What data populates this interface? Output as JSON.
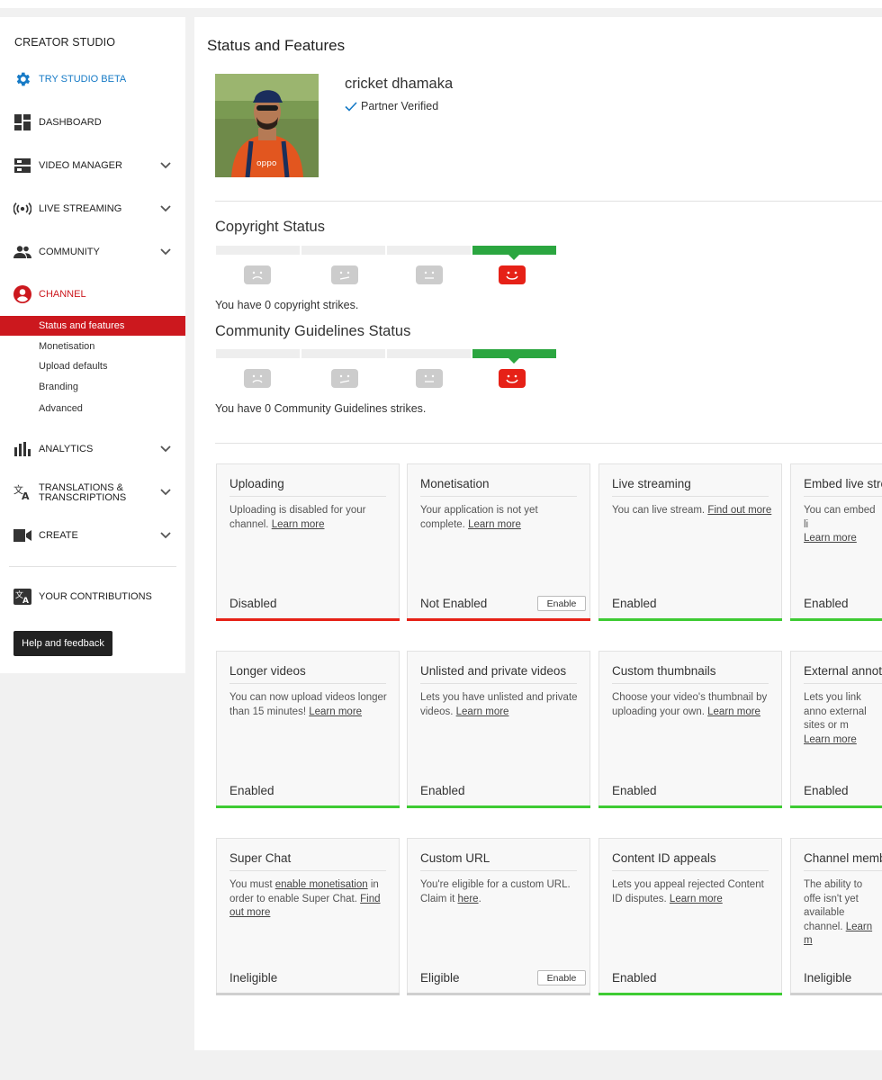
{
  "sidebar": {
    "title": "CREATOR STUDIO",
    "try_beta": "TRY STUDIO BETA",
    "dashboard": "DASHBOARD",
    "video_manager": "VIDEO MANAGER",
    "live_streaming": "LIVE STREAMING",
    "community": "COMMUNITY",
    "channel": "CHANNEL",
    "channel_sub": [
      "Status and features",
      "Monetisation",
      "Upload defaults",
      "Branding",
      "Advanced"
    ],
    "analytics": "ANALYTICS",
    "translations_1": "TRANSLATIONS &",
    "translations_2": "TRANSCRIPTIONS",
    "create": "CREATE",
    "contributions": "YOUR CONTRIBUTIONS",
    "help": "Help and feedback"
  },
  "main": {
    "title": "Status and Features",
    "channel_name": "cricket dhamaka",
    "partner": "Partner Verified",
    "copyright_title": "Copyright Status",
    "copyright_text": "You have 0 copyright strikes.",
    "cg_title": "Community Guidelines Status",
    "cg_text": "You have 0 Community Guidelines strikes."
  },
  "cards": [
    {
      "title": "Uploading",
      "desc": "Uploading is disabled for your channel. ",
      "links": [
        "Learn more"
      ],
      "status": "Disabled",
      "bar": "red"
    },
    {
      "title": "Monetisation",
      "desc": "Your application is not yet complete. ",
      "links": [
        "Learn more"
      ],
      "status": "Not Enabled",
      "bar": "red",
      "button": "Enable"
    },
    {
      "title": "Live streaming",
      "desc": "You can live stream. ",
      "links": [
        "Find out more"
      ],
      "status": "Enabled",
      "bar": "green"
    },
    {
      "title": "Embed live stre",
      "desc": "You can embed li",
      "links": [
        "Learn more"
      ],
      "status": "Enabled",
      "bar": "green"
    },
    {
      "title": "Longer videos",
      "desc": "You can now upload videos longer than 15 minutes! ",
      "links": [
        "Learn more"
      ],
      "status": "Enabled",
      "bar": "green"
    },
    {
      "title": "Unlisted and private videos",
      "desc": "Lets you have unlisted and private videos. ",
      "links": [
        "Learn more"
      ],
      "status": "Enabled",
      "bar": "green"
    },
    {
      "title": "Custom thumbnails",
      "desc": "Choose your video's thumbnail by uploading your own. ",
      "links": [
        "Learn more"
      ],
      "status": "Enabled",
      "bar": "green"
    },
    {
      "title": "External annot",
      "desc": "Lets you link anno external sites or m",
      "links": [
        "Learn more"
      ],
      "status": "Enabled",
      "bar": "green"
    },
    {
      "title": "Super Chat",
      "desc_a": "You must ",
      "link_a": "enable monetisation",
      "desc_b": " in order to enable Super Chat. ",
      "links": [
        "Find out more"
      ],
      "status": "Ineligible",
      "bar": "grey"
    },
    {
      "title": "Custom URL",
      "desc_a": "You're eligible for a custom URL. Claim it ",
      "link_a": "here",
      "desc_b": ".",
      "status": "Eligible",
      "bar": "grey",
      "button": "Enable"
    },
    {
      "title": "Content ID appeals",
      "desc": "Lets you appeal rejected Content ID disputes. ",
      "links": [
        "Learn more"
      ],
      "status": "Enabled",
      "bar": "green"
    },
    {
      "title": "Channel memb",
      "desc": "The ability to offe isn't yet available channel. ",
      "links": [
        "Learn m"
      ],
      "status": "Ineligible",
      "bar": "grey"
    }
  ],
  "colors": {
    "red": "#cc181e",
    "blue": "#167ac6",
    "green": "#2ba640"
  }
}
